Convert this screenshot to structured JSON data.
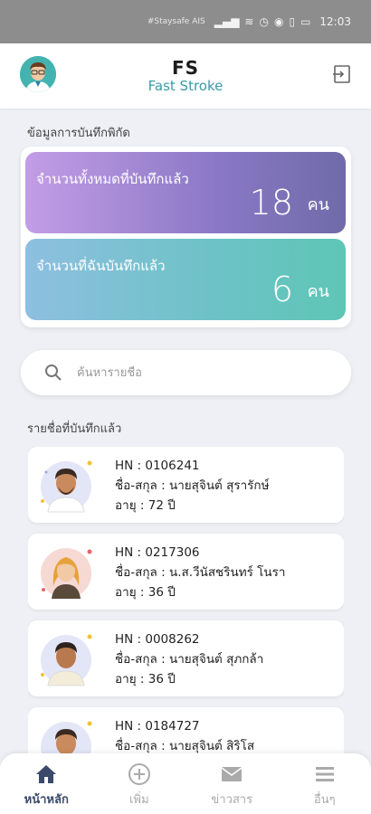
{
  "status_bar": {
    "carrier": "#Staysafe AIS",
    "time": "12:03"
  },
  "header": {
    "title": "FS",
    "subtitle": "Fast Stroke"
  },
  "stats": {
    "section_label": "ข้อมูลการบันทึกพิกัด",
    "total": {
      "label": "จำนวนทั้งหมดที่บันทึกแล้ว",
      "value": "18",
      "unit": "คน"
    },
    "mine": {
      "label": "จำนวนที่ฉันบันทึกแล้ว",
      "value": "6",
      "unit": "คน"
    }
  },
  "search": {
    "placeholder": "ค้นหารายชื่อ"
  },
  "list": {
    "section_label": "รายชื่อที่บันทึกแล้ว",
    "patients": [
      {
        "hn": "HN : 0106241",
        "name": "ชื่อ-สกุล : นายสุจินต์ สุรารักษ์",
        "age": "อายุ : 72 ปี",
        "avatar": "male-avatar"
      },
      {
        "hn": "HN : 0217306",
        "name": "ชื่อ-สกุล : น.ส.วีนัสชรินทร์ โนรา",
        "age": "อายุ : 36 ปี",
        "avatar": "female-avatar"
      },
      {
        "hn": "HN : 0008262",
        "name": "ชื่อ-สกุล : นายสุจินต์ สุภกล้า",
        "age": "อายุ : 36 ปี",
        "avatar": "male-avatar"
      },
      {
        "hn": "HN : 0184727",
        "name": "ชื่อ-สกุล : นายสุจินต์ สิริโส",
        "age": "",
        "avatar": "male-avatar"
      }
    ]
  },
  "nav": {
    "home": "หน้าหลัก",
    "add": "เพิ่ม",
    "news": "ข่าวสาร",
    "more": "อื่นๆ"
  },
  "colors": {
    "accent": "#3a9aa8",
    "nav_active": "#3b4a6b"
  }
}
